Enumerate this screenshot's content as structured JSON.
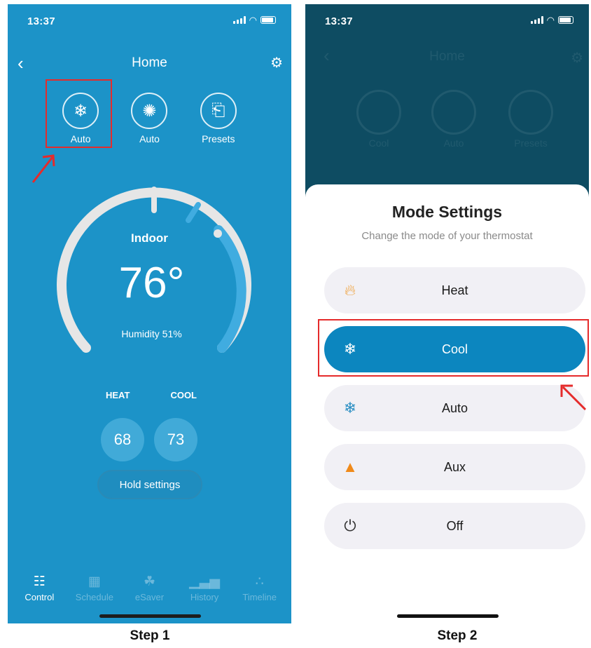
{
  "step1": {
    "status": {
      "time": "13:37"
    },
    "nav": {
      "title": "Home"
    },
    "modes": [
      {
        "label": "Auto",
        "icon": "snowflake-flame-icon"
      },
      {
        "label": "Auto",
        "icon": "fan-icon"
      },
      {
        "label": "Presets",
        "icon": "presets-icon"
      }
    ],
    "dial": {
      "label": "Indoor",
      "temperature": "76°",
      "humidity": "Humidity 51%"
    },
    "heat_label": "HEAT",
    "cool_label": "COOL",
    "heat_value": "68",
    "cool_value": "73",
    "hold_label": "Hold settings",
    "tabs": [
      {
        "label": "Control",
        "icon": "sliders-icon"
      },
      {
        "label": "Schedule",
        "icon": "calendar-icon"
      },
      {
        "label": "eSaver",
        "icon": "leaf-icon"
      },
      {
        "label": "History",
        "icon": "bar-chart-icon"
      },
      {
        "label": "Timeline",
        "icon": "timeline-icon"
      }
    ],
    "caption": "Step 1"
  },
  "step2": {
    "status": {
      "time": "13:37"
    },
    "background": {
      "title": "Home",
      "modes": [
        "Cool",
        "Auto",
        "Presets"
      ]
    },
    "sheet": {
      "title": "Mode Settings",
      "subtitle": "Change the mode of your thermostat",
      "options": [
        {
          "label": "Heat",
          "icon": "flame-outline-icon",
          "color": "#f0a13a"
        },
        {
          "label": "Cool",
          "icon": "snowflake-icon",
          "selected": true
        },
        {
          "label": "Auto",
          "icon": "snowflake-flame-icon",
          "color": "#2b8fc3"
        },
        {
          "label": "Aux",
          "icon": "flame-icon",
          "color": "#f08a1a"
        },
        {
          "label": "Off",
          "icon": "power-icon",
          "color": "#333333"
        }
      ]
    },
    "caption": "Step 2"
  },
  "colors": {
    "primary": "#1c93c8",
    "highlight": "#e52b2b",
    "selected": "#0c86bf"
  }
}
